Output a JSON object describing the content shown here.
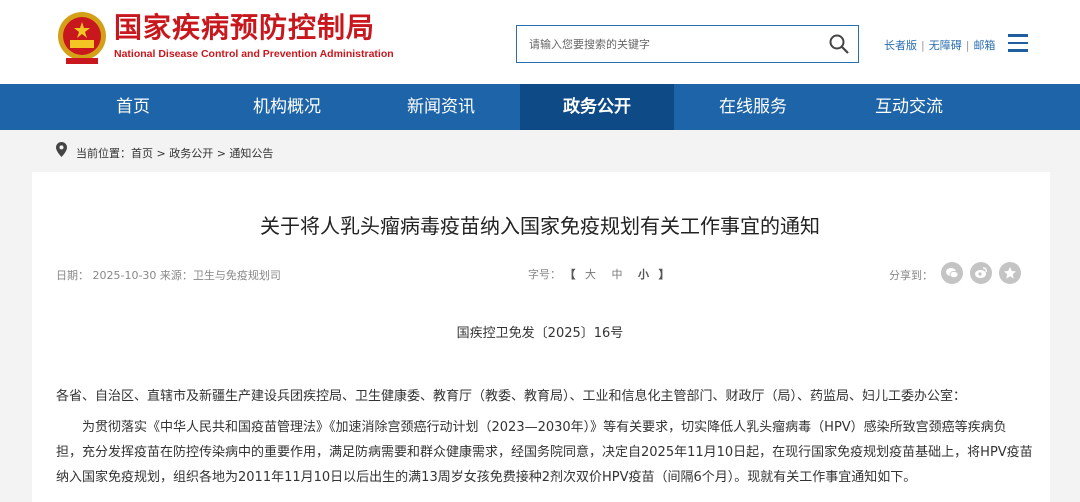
{
  "header": {
    "org_name_cn": "国家疾病预防控制局",
    "org_name_en": "National Disease Control and Prevention Administration",
    "search_placeholder": "请输入您要搜索的关键字",
    "links": [
      "长者版",
      "无障碍",
      "邮箱"
    ],
    "brand_color": "#c8171d"
  },
  "nav": {
    "items": [
      "首页",
      "机构概况",
      "新闻资讯",
      "政务公开",
      "在线服务",
      "互动交流"
    ],
    "active": "政务公开",
    "color": "#1e64a8",
    "active_color": "#0d4a86"
  },
  "breadcrumb": {
    "label": "当前位置：",
    "path": "首页 > 政务公开 > 通知公告"
  },
  "article": {
    "title": "关于将人乳头瘤病毒疫苗纳入国家免疫规划有关工作事宜的通知",
    "date_source": "日期： 2025-10-30 来源：卫生与免疫规划司",
    "font_size_label": "字号：",
    "font_size_open": "【",
    "font_size_options": [
      "大",
      "中",
      "小"
    ],
    "font_size_close": "】",
    "share_label": "分享到：",
    "share_icons": [
      "wechat-icon",
      "weibo-icon",
      "favorite-icon"
    ],
    "doc_number": "国疾控卫免发〔2025〕16号",
    "recipients": "各省、自治区、直辖市及新疆生产建设兵团疾控局、卫生健康委、教育厅（教委、教育局）、工业和信息化主管部门、财政厅（局）、药监局、妇儿工委办公室：",
    "body_lines": [
      "为贯彻落实《中华人民共和国疫苗管理法》《加速消除宫颈癌行动计划（2023—2030年）》等有关要求，切实降低人乳头瘤病毒（HPV）感染所致宫颈癌等疾病负",
      "担，充分发挥疫苗在防控传染病中的重要作用，满足防病需要和群众健康需求，经国务院同意，决定自2025年11月10日起，在现行国家免疫规划疫苗基础上，将HPV疫苗",
      "纳入国家免疫规划，组织各地为2011年11月10日以后出生的满13周岁女孩免费接种2剂次双价HPV疫苗（间隔6个月）。现就有关工作事宜通知如下。"
    ]
  }
}
